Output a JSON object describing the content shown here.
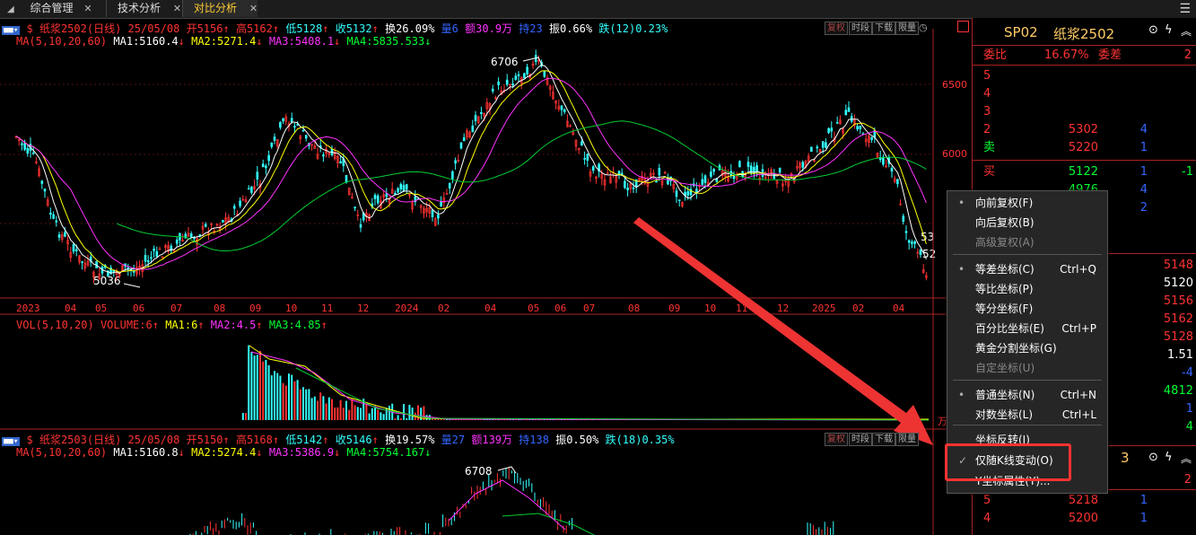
{
  "tabs": [
    {
      "label": "综合管理"
    },
    {
      "label": "技术分析"
    },
    {
      "label": "对比分析"
    }
  ],
  "chart1": {
    "header": {
      "name": "$ 纸浆2502(日线)",
      "date": "25/05/08",
      "open": "开5156",
      "open_arrow": "↑",
      "high": "高5162",
      "high_arrow": "↑",
      "low": "低5128",
      "low_arrow": "↑",
      "close": "收5132",
      "close_arrow": "↑",
      "turnover": "换26.09%",
      "volume": "量6",
      "amount": "额30.9万",
      "hold": "持23",
      "swing": "振0.66%",
      "fall": "跌(12)0.23%"
    },
    "ma": {
      "label": "MA(5,10,20,60)",
      "ma1": "MA1:5160.4",
      "ma1_arrow": "↓",
      "ma2": "MA2:5271.4",
      "ma2_arrow": "↓",
      "ma3": "MA3:5408.1",
      "ma3_arrow": "↓",
      "ma4": "MA4:5835.533",
      "ma4_arrow": "↓"
    },
    "buttons": [
      "复权",
      "时段",
      "下载",
      "限量"
    ],
    "price_axis": [
      "6500",
      "6000"
    ],
    "peak_label": "6706",
    "low_label": "5036",
    "right_label_1": "53",
    "right_label_2": "52",
    "months": [
      "2023",
      "04",
      "05",
      "06",
      "07",
      "08",
      "09",
      "10",
      "11",
      "12",
      "2024",
      "02",
      "04",
      "05",
      "06",
      "07",
      "08",
      "09",
      "10",
      "11",
      "12",
      "2025",
      "02",
      "04"
    ]
  },
  "vol": {
    "label": "VOL(5,10,20)",
    "volume": "VOLUME:6",
    "volume_arrow": "↑",
    "ma1": "MA1:6",
    "ma1_arrow": "↑",
    "ma2": "MA2:4.5",
    "ma2_arrow": "↑",
    "ma3": "MA3:4.85",
    "ma3_arrow": "↑",
    "unit": "万"
  },
  "chart2": {
    "header": {
      "name": "$ 纸浆2503(日线)",
      "date": "25/05/08",
      "open": "开5150",
      "open_arrow": "↑",
      "high": "高5168",
      "high_arrow": "↑",
      "low": "低5142",
      "low_arrow": "↑",
      "close": "收5146",
      "close_arrow": "↑",
      "turnover": "换19.57%",
      "volume": "量27",
      "amount": "额139万",
      "hold": "持138",
      "swing": "振0.50%",
      "fall": "跌(18)0.35%"
    },
    "ma": {
      "label": "MA(5,10,20,60)",
      "ma1": "MA1:5160.8",
      "ma1_arrow": "↓",
      "ma2": "MA2:5274.4",
      "ma2_arrow": "↓",
      "ma3": "MA3:5386.9",
      "ma3_arrow": "↓",
      "ma4": "MA4:5754.167",
      "ma4_arrow": "↓"
    },
    "buttons": [
      "复权",
      "时段",
      "下载",
      "限量"
    ],
    "peak_label": "6708"
  },
  "right_panel": {
    "code": "SP02",
    "name": "纸浆2502",
    "weibi_label": "委比",
    "weibi_value": "16.67%",
    "weicha_label": "委差",
    "weicha_value": "2",
    "sell_rows": [
      {
        "level": "5",
        "price": "",
        "vol": ""
      },
      {
        "level": "4",
        "price": "",
        "vol": ""
      },
      {
        "level": "3",
        "price": "",
        "vol": ""
      },
      {
        "level": "2",
        "price": "5302",
        "vol": "4"
      },
      {
        "level": "卖",
        "price": "5220",
        "vol": "1"
      }
    ],
    "buy_rows": [
      {
        "level": "买",
        "price": "5122",
        "vol": "1",
        "chg": "-1"
      },
      {
        "level": "",
        "price": "4976",
        "vol": "4",
        "chg": ""
      },
      {
        "level": "",
        "price": "",
        "vol": "2",
        "chg": ""
      }
    ],
    "quote_values": [
      "5148",
      "5120",
      "5156",
      "5162",
      "5128",
      "1.51",
      "-4",
      "4812",
      "1",
      "4"
    ],
    "panel2_code_suffix": "3",
    "panel2_weicha": "2",
    "panel2_rows": [
      {
        "level": "5",
        "price": "5218",
        "vol": "1"
      },
      {
        "level": "4",
        "price": "5200",
        "vol": "1"
      }
    ]
  },
  "context_menu": {
    "items": [
      {
        "label": "向前复权(F)",
        "shortcut": "",
        "checked": "•",
        "disabled": false
      },
      {
        "label": "向后复权(B)",
        "shortcut": "",
        "checked": "",
        "disabled": false
      },
      {
        "label": "高级复权(A)",
        "shortcut": "",
        "checked": "",
        "disabled": true
      },
      {
        "label": "等差坐标(C)",
        "shortcut": "Ctrl+Q",
        "checked": "•",
        "disabled": false
      },
      {
        "label": "等比坐标(P)",
        "shortcut": "",
        "checked": "",
        "disabled": false
      },
      {
        "label": "等分坐标(F)",
        "shortcut": "",
        "checked": "",
        "disabled": false
      },
      {
        "label": "百分比坐标(E)",
        "shortcut": "Ctrl+P",
        "checked": "",
        "disabled": false
      },
      {
        "label": "黄金分割坐标(G)",
        "shortcut": "",
        "checked": "",
        "disabled": false
      },
      {
        "label": "自定坐标(U)",
        "shortcut": "",
        "checked": "",
        "disabled": true
      },
      {
        "label": "普通坐标(N)",
        "shortcut": "Ctrl+N",
        "checked": "•",
        "disabled": false
      },
      {
        "label": "对数坐标(L)",
        "shortcut": "Ctrl+L",
        "checked": "",
        "disabled": false
      },
      {
        "label": "坐标反转(I)",
        "shortcut": "",
        "checked": "",
        "disabled": false
      },
      {
        "label": "仅随K线变动(O)",
        "shortcut": "",
        "checked": "✓",
        "disabled": false
      },
      {
        "label": "Y坐标属性(Y)...",
        "shortcut": "",
        "checked": "",
        "disabled": false
      }
    ]
  },
  "colors": {
    "up": "#ff3333",
    "down": "#33ffff",
    "ma1": "#ffffff",
    "ma2": "#ffff00",
    "ma3": "#ff33ff",
    "ma4": "#00cc33",
    "arrow": "#ff3333"
  }
}
